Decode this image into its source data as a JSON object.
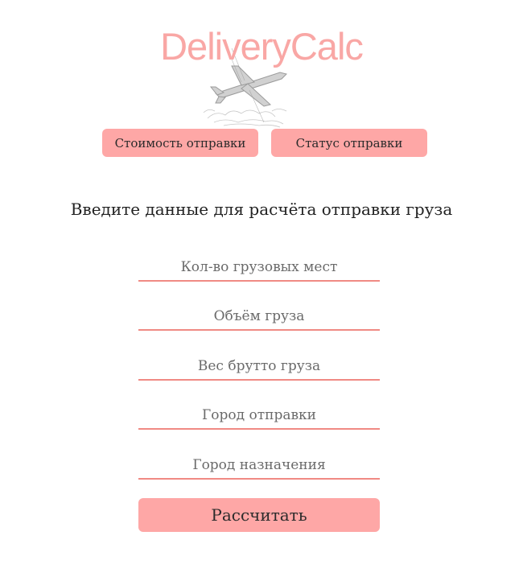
{
  "header": {
    "logo_text": "DeliveryCalc",
    "logo_color": "#f9a7a5",
    "logo_image": "airplane-sketch-icon"
  },
  "nav": {
    "cost_label": "Стоимость отправки",
    "status_label": "Статус отправки",
    "button_color": "#fea7a6"
  },
  "form": {
    "heading": "Введите данные для расчёта отправки груза",
    "fields": [
      {
        "placeholder": "Кол-во грузовых мест",
        "value": ""
      },
      {
        "placeholder": "Объём груза",
        "value": ""
      },
      {
        "placeholder": "Вес брутто груза",
        "value": ""
      },
      {
        "placeholder": "Город отправки",
        "value": ""
      },
      {
        "placeholder": "Город назначения",
        "value": ""
      }
    ],
    "underline_color": "#f08a84",
    "submit_label": "Рассчитать"
  }
}
